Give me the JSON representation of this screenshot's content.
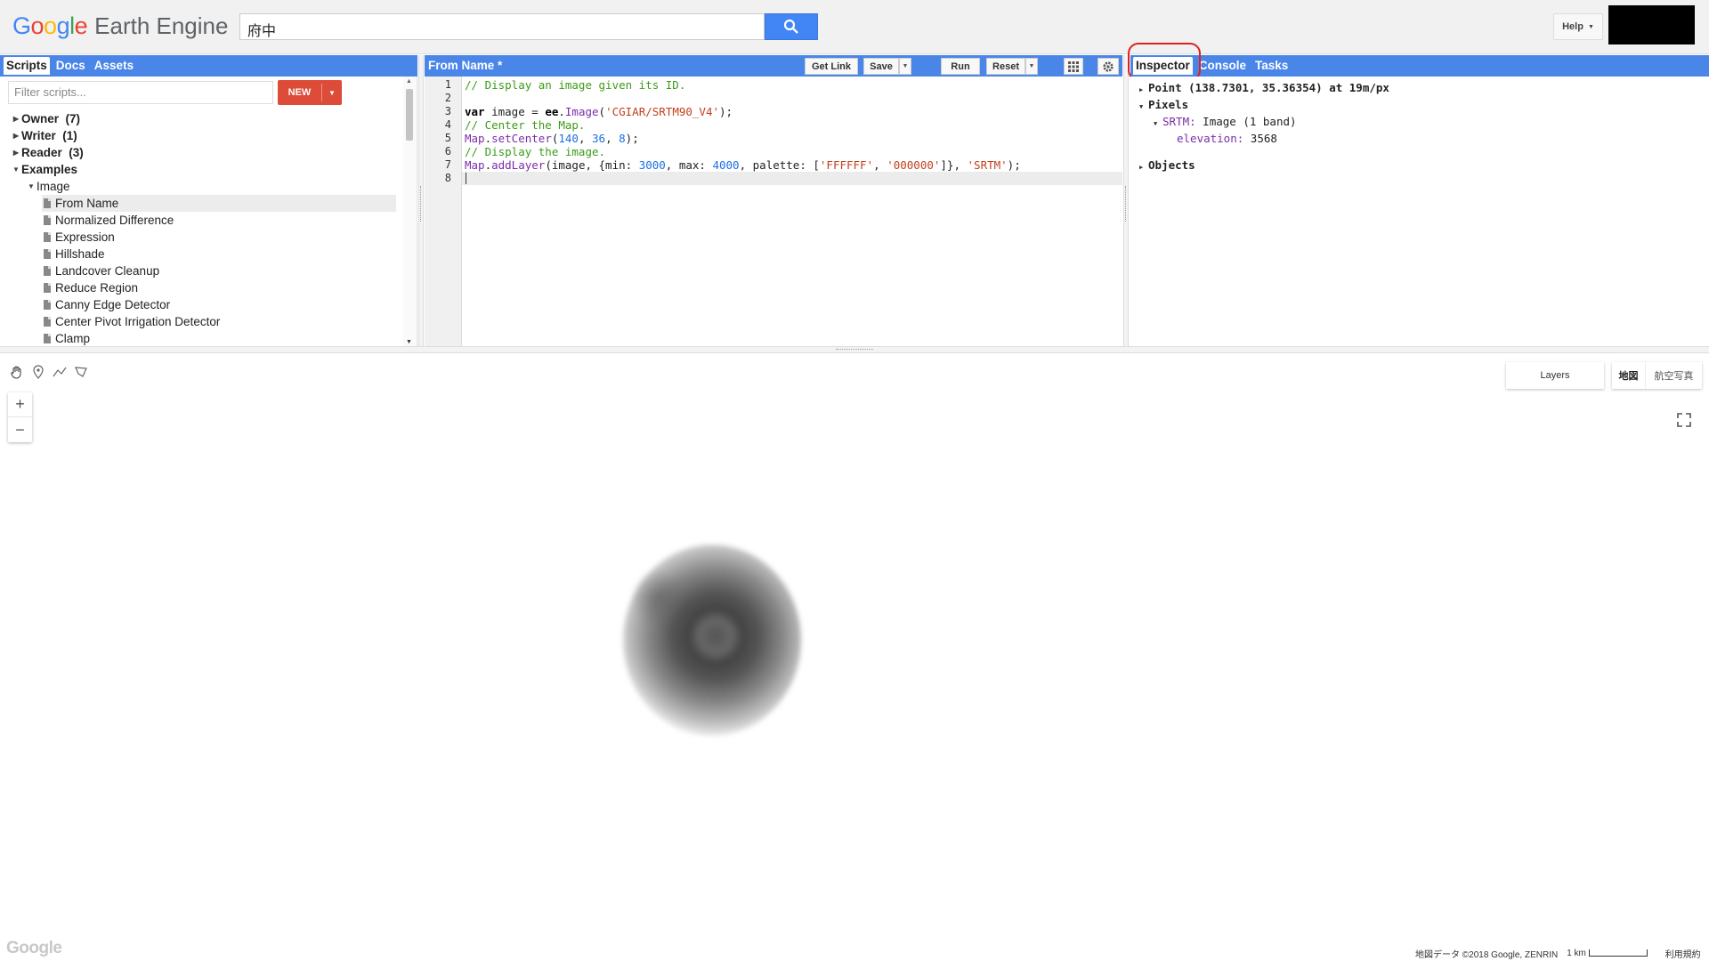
{
  "header": {
    "logo_google": "Google",
    "logo_product": "Earth Engine",
    "search_value": "府中",
    "help_label": "Help"
  },
  "left_panel": {
    "tabs": [
      {
        "label": "Scripts",
        "active": true
      },
      {
        "label": "Docs",
        "active": false
      },
      {
        "label": "Assets",
        "active": false
      }
    ],
    "filter_placeholder": "Filter scripts...",
    "new_button": "NEW",
    "tree": [
      {
        "label": "Owner  (7)",
        "type": "folder",
        "expanded": false
      },
      {
        "label": "Writer  (1)",
        "type": "folder",
        "expanded": false
      },
      {
        "label": "Reader  (3)",
        "type": "folder",
        "expanded": false
      },
      {
        "label": "Examples",
        "type": "folder",
        "expanded": true
      },
      {
        "label": "Image",
        "type": "subfolder",
        "expanded": true
      },
      {
        "label": "From Name",
        "type": "file",
        "selected": true
      },
      {
        "label": "Normalized Difference",
        "type": "file"
      },
      {
        "label": "Expression",
        "type": "file"
      },
      {
        "label": "Hillshade",
        "type": "file"
      },
      {
        "label": "Landcover Cleanup",
        "type": "file"
      },
      {
        "label": "Reduce Region",
        "type": "file"
      },
      {
        "label": "Canny Edge Detector",
        "type": "file"
      },
      {
        "label": "Center Pivot Irrigation Detector",
        "type": "file"
      },
      {
        "label": "Clamp",
        "type": "file"
      }
    ]
  },
  "editor": {
    "title": "From Name *",
    "buttons": {
      "get_link": "Get Link",
      "save": "Save",
      "run": "Run",
      "reset": "Reset"
    },
    "line_numbers": [
      "1",
      "2",
      "3",
      "4",
      "5",
      "6",
      "7",
      "8"
    ],
    "lines": [
      [
        {
          "t": "// Display an image given its ID.",
          "c": "cm"
        }
      ],
      [],
      [
        {
          "t": "var",
          "c": "kw"
        },
        {
          "t": " image = ",
          "c": ""
        },
        {
          "t": "ee",
          "c": "kw"
        },
        {
          "t": ".",
          "c": ""
        },
        {
          "t": "Image",
          "c": "fn"
        },
        {
          "t": "(",
          "c": ""
        },
        {
          "t": "'CGIAR/SRTM90_V4'",
          "c": "str"
        },
        {
          "t": ");",
          "c": ""
        }
      ],
      [
        {
          "t": "// Center the Map.",
          "c": "cm"
        }
      ],
      [
        {
          "t": "Map",
          "c": "fn"
        },
        {
          "t": ".",
          "c": ""
        },
        {
          "t": "setCenter",
          "c": "fn"
        },
        {
          "t": "(",
          "c": ""
        },
        {
          "t": "140",
          "c": "num"
        },
        {
          "t": ", ",
          "c": ""
        },
        {
          "t": "36",
          "c": "num"
        },
        {
          "t": ", ",
          "c": ""
        },
        {
          "t": "8",
          "c": "num"
        },
        {
          "t": ");",
          "c": ""
        }
      ],
      [
        {
          "t": "// Display the image.",
          "c": "cm"
        }
      ],
      [
        {
          "t": "Map",
          "c": "fn"
        },
        {
          "t": ".",
          "c": ""
        },
        {
          "t": "addLayer",
          "c": "fn"
        },
        {
          "t": "(image, {min: ",
          "c": ""
        },
        {
          "t": "3000",
          "c": "num"
        },
        {
          "t": ", max: ",
          "c": ""
        },
        {
          "t": "4000",
          "c": "num"
        },
        {
          "t": ", palette: [",
          "c": ""
        },
        {
          "t": "'FFFFFF'",
          "c": "str"
        },
        {
          "t": ", ",
          "c": ""
        },
        {
          "t": "'000000'",
          "c": "str"
        },
        {
          "t": "]}, ",
          "c": ""
        },
        {
          "t": "'SRTM'",
          "c": "str"
        },
        {
          "t": ");",
          "c": ""
        }
      ],
      []
    ]
  },
  "right_panel": {
    "tabs": [
      {
        "label": "Inspector",
        "active": true
      },
      {
        "label": "Console",
        "active": false
      },
      {
        "label": "Tasks",
        "active": false
      }
    ],
    "point": "Point (138.7301, 35.36354) at 19m/px",
    "pixels_label": "Pixels",
    "layer_name": "SRTM:",
    "layer_desc": " Image (1 band)",
    "band_name": "elevation:",
    "band_value": "3568",
    "objects_label": "Objects"
  },
  "map": {
    "layers_label": "Layers",
    "maptype_map": "地図",
    "maptype_satellite": "航空写真",
    "zoom_in": "+",
    "zoom_out": "−",
    "google_mark": "Google",
    "attribution": "地図データ ©2018 Google, ZENRIN",
    "scale_label": "1 km",
    "terms": "利用規約"
  },
  "colors": {
    "accent": "#4a86e8",
    "new_button": "#dd4b39",
    "search_button": "#4285f4",
    "highlight": "#e02020"
  }
}
